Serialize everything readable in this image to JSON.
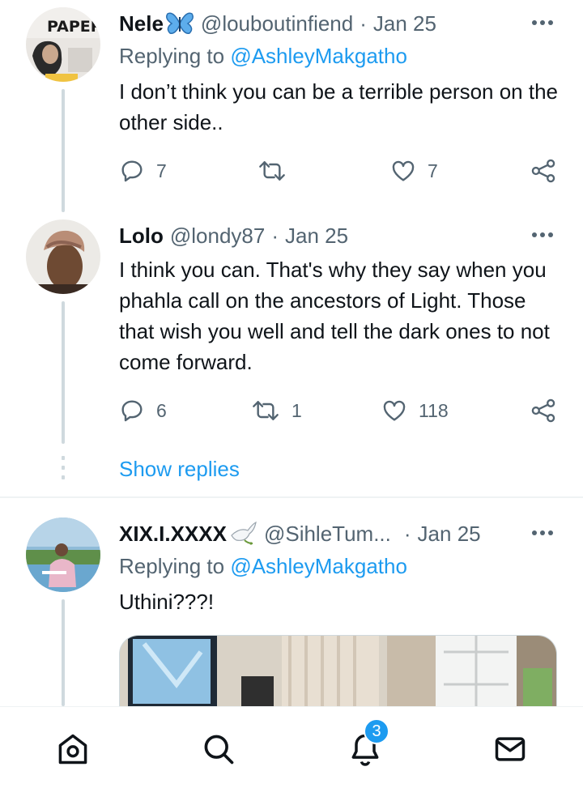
{
  "tweets": [
    {
      "name": "Nele",
      "handle": "@louboutinfiend",
      "separator": "·",
      "date": "Jan 25",
      "replying_prefix": "Replying to",
      "replying_to": "@AshleyMakgatho",
      "text": "I don’t think you can be a terrible person on the other side..",
      "replies": "7",
      "retweets": "",
      "likes": "7",
      "avatar_label": "PAPER"
    },
    {
      "name": "Lolo",
      "handle": "@londy87",
      "separator": "·",
      "date": "Jan 25",
      "text": "I think you can. That's why they say when you phahla call on the ancestors of Light. Those that wish you well and tell the dark ones to not come forward.",
      "replies": "6",
      "retweets": "1",
      "likes": "118"
    },
    {
      "name": "XIX.I.XXXX",
      "handle": "@SihleTum...",
      "separator": "·",
      "date": "Jan 25",
      "replying_prefix": "Replying to",
      "replying_to": "@AshleyMakgatho",
      "text": "Uthini???!"
    }
  ],
  "show_replies": "Show replies",
  "nav": {
    "items": [
      "home-icon",
      "search-icon",
      "notifications-icon",
      "messages-icon"
    ],
    "notification_count": "3"
  },
  "colors": {
    "accent": "#1d9bf0",
    "secondary_text": "#536471",
    "thread_line": "#cfd9de"
  }
}
